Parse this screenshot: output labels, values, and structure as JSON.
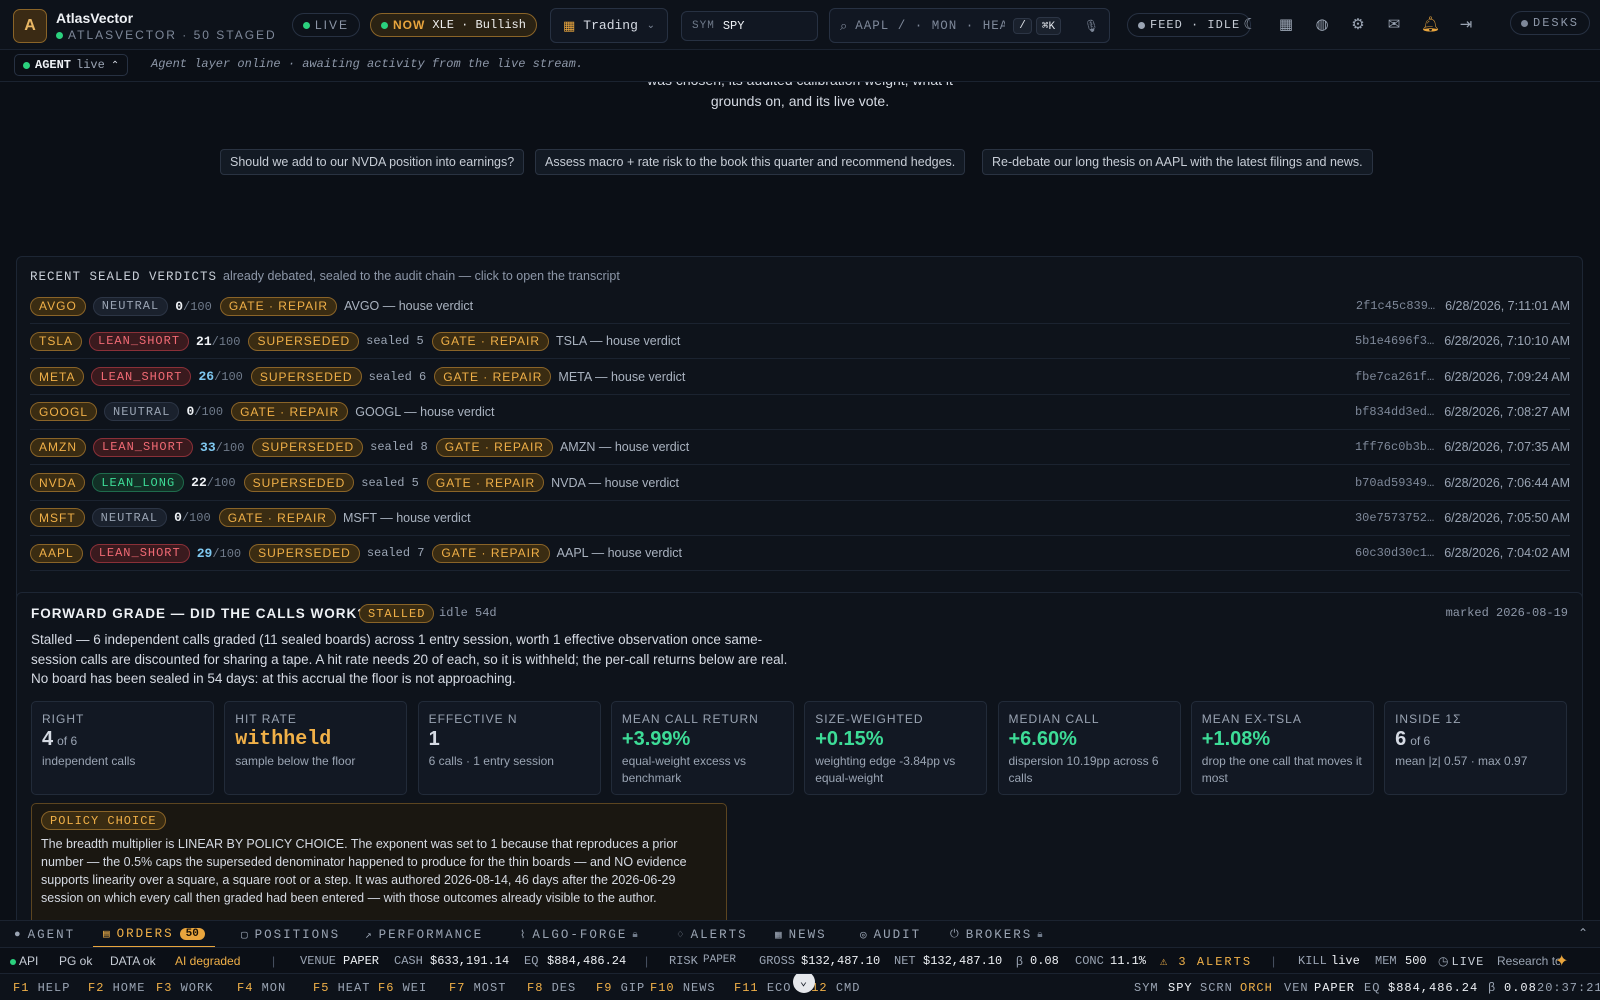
{
  "app": {
    "name": "AtlasVector",
    "subtitle": "ATLASVECTOR · 50 STAGED",
    "logo_letter": "A"
  },
  "header": {
    "live_label": "LIVE",
    "now_label": "NOW",
    "now_value": "XLE · Bullish",
    "desk_mode": "Trading",
    "sym_label": "SYM",
    "sym_value": "SPY",
    "search_placeholder": "AAPL / · MON · HEAT",
    "search_key": "/",
    "search_shortcut": "⌘K",
    "feed_label": "FEED · IDLE",
    "desks_label": "DESKS",
    "icons": [
      "moon-icon",
      "grid-icon",
      "globe-icon",
      "gear-icon",
      "inbox-icon",
      "bell-icon",
      "logout-icon"
    ]
  },
  "agent": {
    "label": "AGENT",
    "state": "live",
    "message": "Agent layer online · awaiting activity from the live stream."
  },
  "intro": {
    "line1": "was chosen, its audited calibration weight, what it",
    "line2": "grounds on, and its live vote."
  },
  "suggestions": [
    "Should we add to our NVDA position into earnings?",
    "Assess macro + rate risk to the book this quarter and recommend hedges.",
    "Re-debate our long thesis on AAPL with the latest filings and news."
  ],
  "verdicts": {
    "title": "RECENT SEALED VERDICTS",
    "subtitle": "already debated, sealed to the audit chain — click to open the transcript",
    "rows": [
      {
        "ticker": "AVGO",
        "stance": "NEUTRAL",
        "score": "0",
        "out_of": "/100",
        "superseded": "",
        "sealed": "",
        "gate": "GATE · REPAIR",
        "text": "AVGO — house verdict",
        "hash": "2f1c45c839…",
        "time": "6/28/2026, 7:11:01 AM"
      },
      {
        "ticker": "TSLA",
        "stance": "LEAN_SHORT",
        "score": "21",
        "out_of": "/100",
        "superseded": "SUPERSEDED",
        "sealed": "sealed 5",
        "gate": "GATE · REPAIR",
        "text": "TSLA — house verdict",
        "hash": "5b1e4696f3…",
        "time": "6/28/2026, 7:10:10 AM"
      },
      {
        "ticker": "META",
        "stance": "LEAN_SHORT",
        "score": "26",
        "out_of": "/100",
        "superseded": "SUPERSEDED",
        "sealed": "sealed 6",
        "gate": "GATE · REPAIR",
        "text": "META — house verdict",
        "hash": "fbe7ca261f…",
        "time": "6/28/2026, 7:09:24 AM"
      },
      {
        "ticker": "GOOGL",
        "stance": "NEUTRAL",
        "score": "0",
        "out_of": "/100",
        "superseded": "",
        "sealed": "",
        "gate": "GATE · REPAIR",
        "text": "GOOGL — house verdict",
        "hash": "bf834dd3ed…",
        "time": "6/28/2026, 7:08:27 AM"
      },
      {
        "ticker": "AMZN",
        "stance": "LEAN_SHORT",
        "score": "33",
        "out_of": "/100",
        "superseded": "SUPERSEDED",
        "sealed": "sealed 8",
        "gate": "GATE · REPAIR",
        "text": "AMZN — house verdict",
        "hash": "1ff76c0b3b…",
        "time": "6/28/2026, 7:07:35 AM"
      },
      {
        "ticker": "NVDA",
        "stance": "LEAN_LONG",
        "score": "22",
        "out_of": "/100",
        "superseded": "SUPERSEDED",
        "sealed": "sealed 5",
        "gate": "GATE · REPAIR",
        "text": "NVDA — house verdict",
        "hash": "b70ad59349…",
        "time": "6/28/2026, 7:06:44 AM"
      },
      {
        "ticker": "MSFT",
        "stance": "NEUTRAL",
        "score": "0",
        "out_of": "/100",
        "superseded": "",
        "sealed": "",
        "gate": "GATE · REPAIR",
        "text": "MSFT — house verdict",
        "hash": "30e7573752…",
        "time": "6/28/2026, 7:05:50 AM"
      },
      {
        "ticker": "AAPL",
        "stance": "LEAN_SHORT",
        "score": "29",
        "out_of": "/100",
        "superseded": "SUPERSEDED",
        "sealed": "sealed 7",
        "gate": "GATE · REPAIR",
        "text": "AAPL — house verdict",
        "hash": "60c30d30c1…",
        "time": "6/28/2026, 7:04:02 AM"
      }
    ]
  },
  "forward_grade": {
    "title": "FORWARD GRADE — DID THE CALLS WORK?",
    "status": "STALLED",
    "idle": "idle 54d",
    "marked": "marked 2026-08-19",
    "description": "Stalled — 6 independent calls graded (11 sealed boards) across 1 entry session, worth 1 effective observation once same-session calls are discounted for sharing a tape. A hit rate needs 20 of each, so it is withheld; the per-call returns below are real. No board has been sealed in 54 days: at this accrual the floor is not approaching.",
    "stats": [
      {
        "label": "RIGHT",
        "value": "4",
        "suffix": "of 6",
        "sub": "independent calls",
        "tone": "plain"
      },
      {
        "label": "HIT RATE",
        "value": "withheld",
        "suffix": "",
        "sub": "sample below the floor",
        "tone": "amber"
      },
      {
        "label": "EFFECTIVE N",
        "value": "1",
        "suffix": "",
        "sub": "6 calls · 1 entry session",
        "tone": "plain"
      },
      {
        "label": "MEAN CALL RETURN",
        "value": "+3.99%",
        "suffix": "",
        "sub": "equal-weight excess vs benchmark",
        "tone": "green"
      },
      {
        "label": "SIZE-WEIGHTED",
        "value": "+0.15%",
        "suffix": "",
        "sub": "weighting edge -3.84pp vs equal-weight",
        "tone": "green"
      },
      {
        "label": "MEDIAN CALL",
        "value": "+6.60%",
        "suffix": "",
        "sub": "dispersion 10.19pp across 6 calls",
        "tone": "green"
      },
      {
        "label": "MEAN EX-TSLA",
        "value": "+1.08%",
        "suffix": "",
        "sub": "drop the one call that moves it most",
        "tone": "green"
      },
      {
        "label": "INSIDE 1Σ",
        "value": "6",
        "suffix": "of 6",
        "sub": "mean |z| 0.57 · max 0.97",
        "tone": "plain"
      }
    ],
    "policy": {
      "label": "POLICY CHOICE",
      "text": "The breadth multiplier is LINEAR BY POLICY CHOICE. The exponent was set to 1 because that reproduces a prior number — the 0.5% caps the superseded denominator happened to produce for the thin boards — and NO evidence supports linearity over a square, a square root or a step. It was authored 2026-08-14, 46 days after the 2026-06-29 session on which every call then graded had been entered — with those outcomes already visible to the author."
    }
  },
  "tabs": [
    {
      "label": "AGENT",
      "icon": "●",
      "lock": false
    },
    {
      "label": "ORDERS",
      "icon": "▤",
      "lock": false,
      "count": "50"
    },
    {
      "label": "POSITIONS",
      "icon": "▢",
      "lock": false
    },
    {
      "label": "PERFORMANCE",
      "icon": "↗",
      "lock": false
    },
    {
      "label": "ALGO-FORGE",
      "icon": "⌇",
      "lock": true
    },
    {
      "label": "ALERTS",
      "icon": "♢",
      "lock": false
    },
    {
      "label": "NEWS",
      "icon": "▦",
      "lock": false
    },
    {
      "label": "AUDIT",
      "icon": "◎",
      "lock": false
    },
    {
      "label": "BROKERS",
      "icon": "⏻",
      "lock": true
    }
  ],
  "status": {
    "api": "API",
    "pg": "PG ok",
    "data": "DATA ok",
    "ai": "AI degraded",
    "venue_label": "VENUE",
    "venue": "PAPER",
    "cash_label": "CASH",
    "cash": "$633,191.14",
    "eq_label": "EQ",
    "eq": "$884,486.24",
    "risk_label": "RISK",
    "risk": "PAPER",
    "gross_label": "GROSS",
    "gross": "$132,487.10",
    "net_label": "NET",
    "net": "$132,487.10",
    "beta_label": "β",
    "beta": "0.08",
    "conc_label": "CONC",
    "conc": "11.1%",
    "alerts": "⚠ 3 ALERTS",
    "kill_label": "KILL",
    "kill": "live",
    "mem_label": "MEM",
    "mem": "500",
    "live": "LIVE",
    "research": "Research tour"
  },
  "fkeys": [
    {
      "key": "F1",
      "label": "HELP"
    },
    {
      "key": "F2",
      "label": "HOME"
    },
    {
      "key": "F3",
      "label": "WORK"
    },
    {
      "key": "F4",
      "label": "MON"
    },
    {
      "key": "F5",
      "label": "HEAT"
    },
    {
      "key": "F6",
      "label": "WEI"
    },
    {
      "key": "F7",
      "label": "MOST"
    },
    {
      "key": "F8",
      "label": "DES"
    },
    {
      "key": "F9",
      "label": "GIP"
    },
    {
      "key": "F10",
      "label": "NEWS"
    },
    {
      "key": "F11",
      "label": "ECO"
    },
    {
      "key": "F12",
      "label": "CMD"
    }
  ],
  "footer_right": {
    "sym_label": "SYM",
    "sym": "SPY",
    "scrn_label": "SCRN",
    "scrn": "ORCH",
    "ven_label": "VEN",
    "ven": "PAPER",
    "eq_label": "EQ",
    "eq": "$884,486.24",
    "beta_label": "β",
    "beta": "0.08",
    "clock": "20:37:21"
  }
}
